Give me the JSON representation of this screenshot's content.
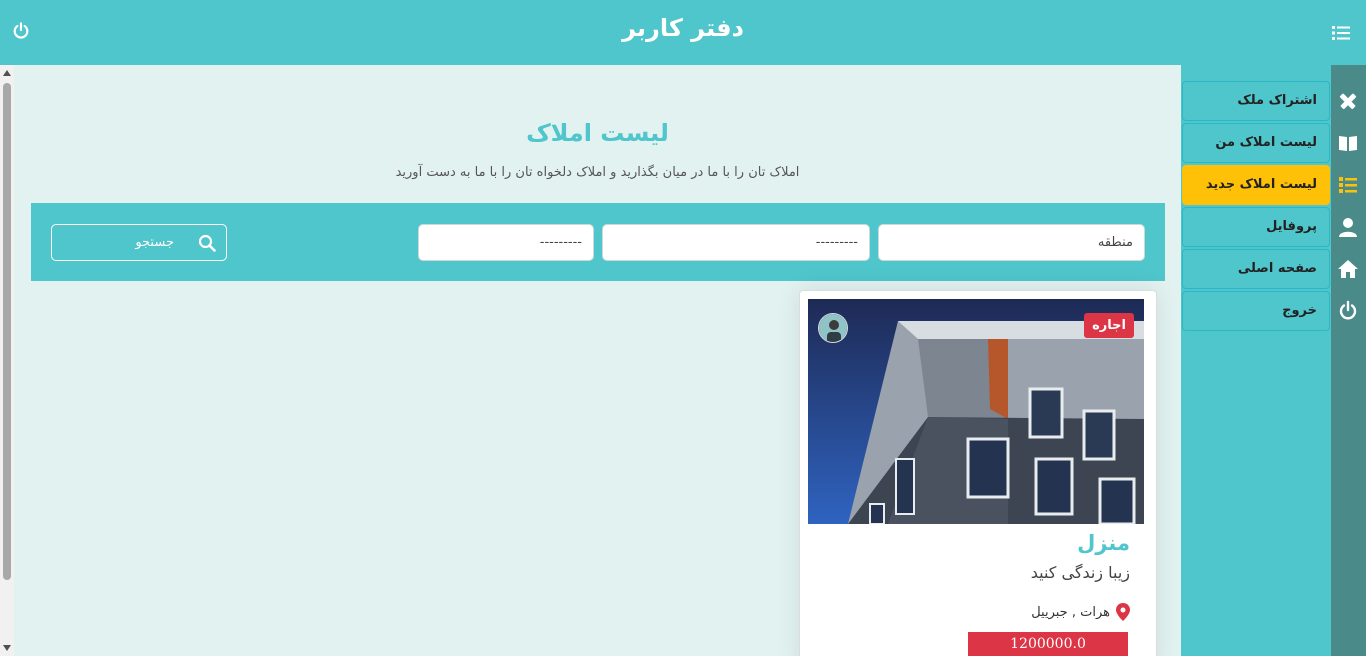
{
  "header": {
    "title": "دفتر کاربر",
    "power_icon": "power-icon",
    "menu_icon": "list-icon"
  },
  "page": {
    "title": "لیست املاک",
    "subtitle": "املاک تان را با ما در میان بگذارید و املاک دلخواه تان را با ما به دست آورید"
  },
  "filters": {
    "region_placeholder": "منطقه",
    "select1_value": "---------",
    "select2_value": "---------",
    "search_placeholder": "جستجو"
  },
  "card": {
    "badge": "اجاره",
    "title": "منزل",
    "description": "زیبا زندگی کنید",
    "location": "هرات , جبرییل",
    "price": "1200000.0"
  },
  "sidebar": {
    "items": [
      {
        "label": "اشتراک ملک",
        "icon": "tools-icon",
        "active": false
      },
      {
        "label": "لیست املاک من",
        "icon": "book-icon",
        "active": false
      },
      {
        "label": "لیست املاک جدید",
        "icon": "list-icon",
        "active": true
      },
      {
        "label": "پروفایل",
        "icon": "user-icon",
        "active": false
      },
      {
        "label": "صفحه اصلی",
        "icon": "home-icon",
        "active": false
      },
      {
        "label": "خروج",
        "icon": "power-icon",
        "active": false
      }
    ]
  },
  "colors": {
    "primary": "#4fc5cc",
    "active": "#ffc107",
    "danger": "#dc3545",
    "background": "#e2f2f1",
    "iconbar": "#4a8b8a"
  }
}
